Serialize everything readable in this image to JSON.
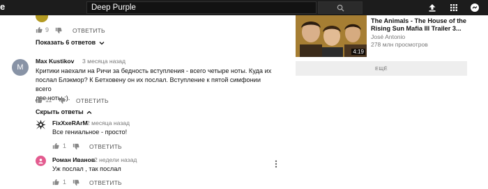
{
  "header": {
    "logo_fragment": "e",
    "search_value": "Deep Purple"
  },
  "top_comment": {
    "likes": "9",
    "reply_label": "ОТВЕТИТЬ",
    "show_replies": "Показать 6 ответов"
  },
  "comment": {
    "avatar_letter": "M",
    "author": "Max Kustikov",
    "date": "3 месяца назад",
    "lines": [
      "Критики наехали на Ричи за бедность вступления - всего четыре ноты. Куда их",
      "послал Блэкмор? К Бетховену он их послал. Вступление к пятой симфонии всего",
      "две ноты :)."
    ],
    "likes": "11",
    "reply_label": "ОТВЕТИТЬ",
    "hide_replies": "Скрыть ответы"
  },
  "replies": [
    {
      "author": "FixXxeRArM",
      "date": "2 месяца назад",
      "text": "Все гениальное - просто!",
      "likes": "1",
      "reply_label": "ОТВЕТИТЬ"
    },
    {
      "author": "Роман Иванов",
      "date": "2 недели назад",
      "text": "Уж послал , так послал",
      "likes": "1",
      "reply_label": "ОТВЕТИТЬ"
    }
  ],
  "sidebar": {
    "video": {
      "title_line1": "The Animals - The House of the",
      "title_line2": "Rising Sun Mafia III Trailer 3...",
      "channel": "José Antonio",
      "views": "278 млн просмотров",
      "duration": "4:19"
    },
    "more_label": "ЕЩЁ"
  }
}
